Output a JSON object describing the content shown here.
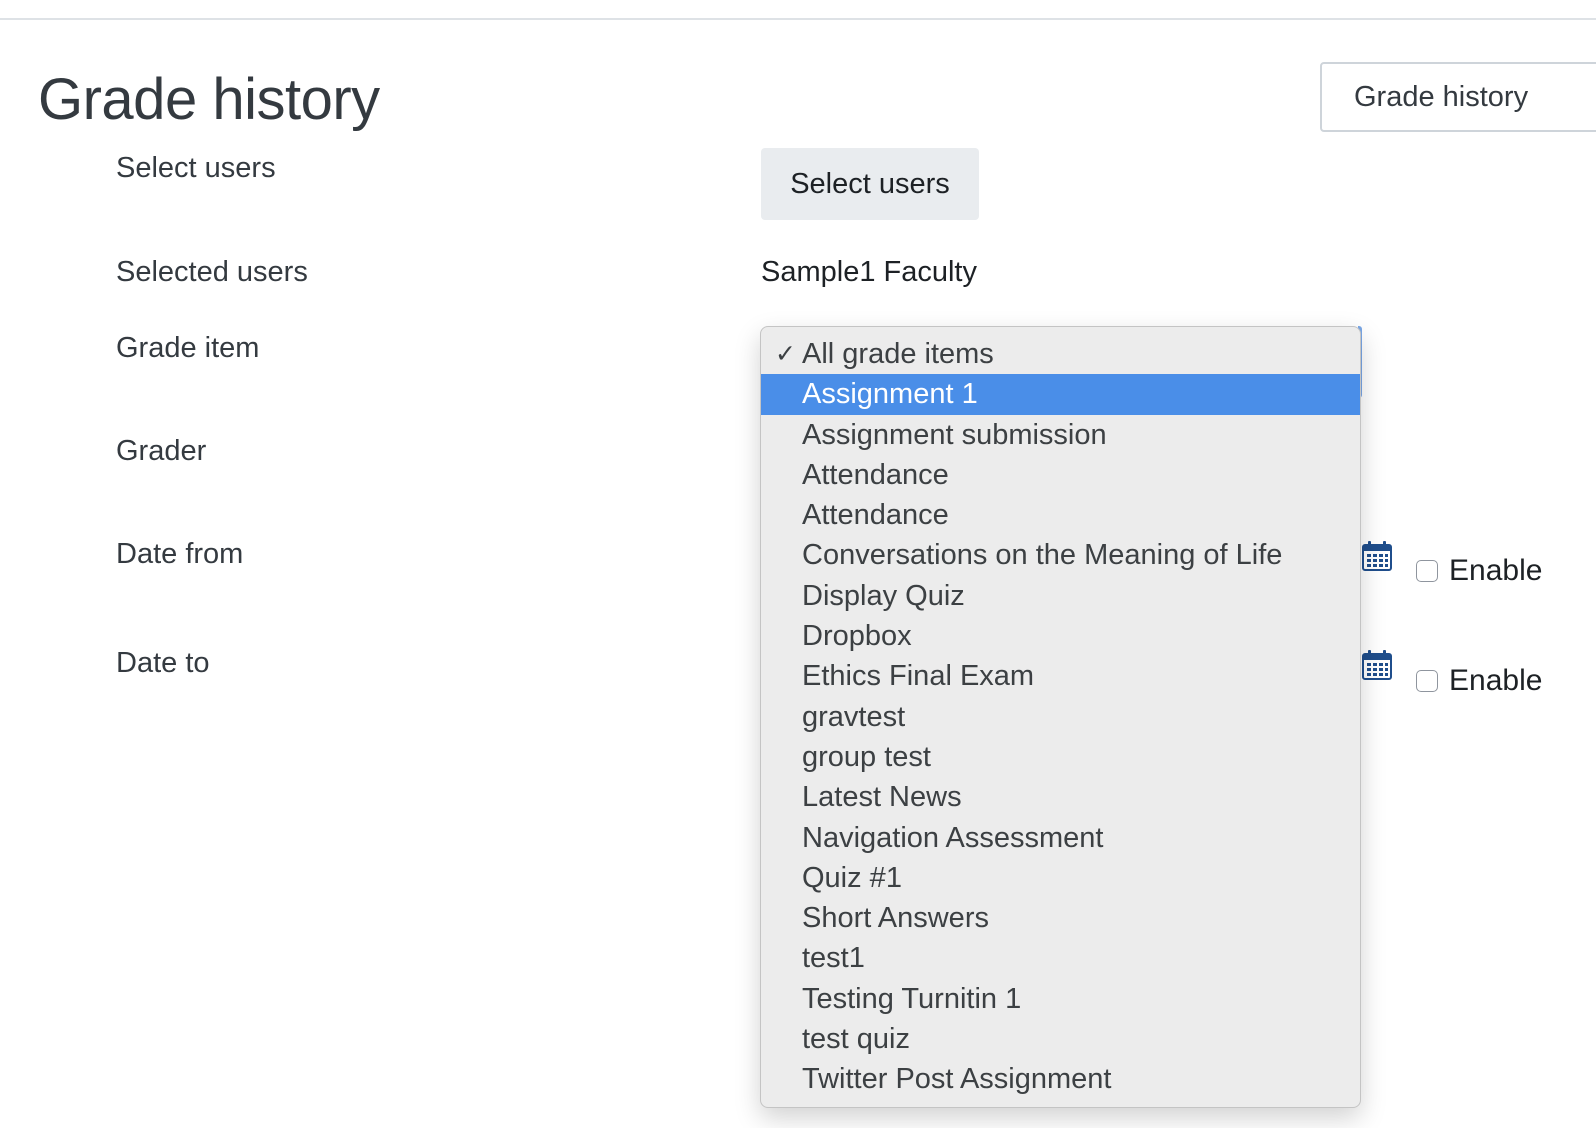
{
  "header": {
    "title": "Grade history"
  },
  "report_selector": {
    "value": "Grade history"
  },
  "form": {
    "select_users_label": "Select users",
    "select_users_button": "Select users",
    "selected_users_label": "Selected users",
    "selected_users_value": "Sample1 Faculty",
    "grade_item_label": "Grade item",
    "grader_label": "Grader",
    "date_from_label": "Date from",
    "date_to_label": "Date to",
    "date_from_enable": "Enable",
    "date_to_enable": "Enable"
  },
  "grade_item_dropdown": {
    "checked_index": 0,
    "highlighted_index": 1,
    "options": [
      "All grade items",
      "Assignment 1",
      "Assignment submission",
      "Attendance",
      "Attendance",
      "Conversations on the Meaning of Life",
      "Display Quiz",
      "Dropbox",
      "Ethics Final Exam",
      "gravtest",
      "group test",
      "Latest News",
      "Navigation Assessment",
      "Quiz #1",
      "Short Answers",
      "test1",
      "Testing Turnitin 1",
      "test quiz",
      "Twitter Post Assignment"
    ]
  },
  "icons": {
    "calendar": "calendar-icon",
    "checkmark": "check-icon"
  },
  "colors": {
    "highlight": "#4a8ee8",
    "calendar_icon": "#1f4e8c",
    "button_bg": "#e9ecef"
  }
}
